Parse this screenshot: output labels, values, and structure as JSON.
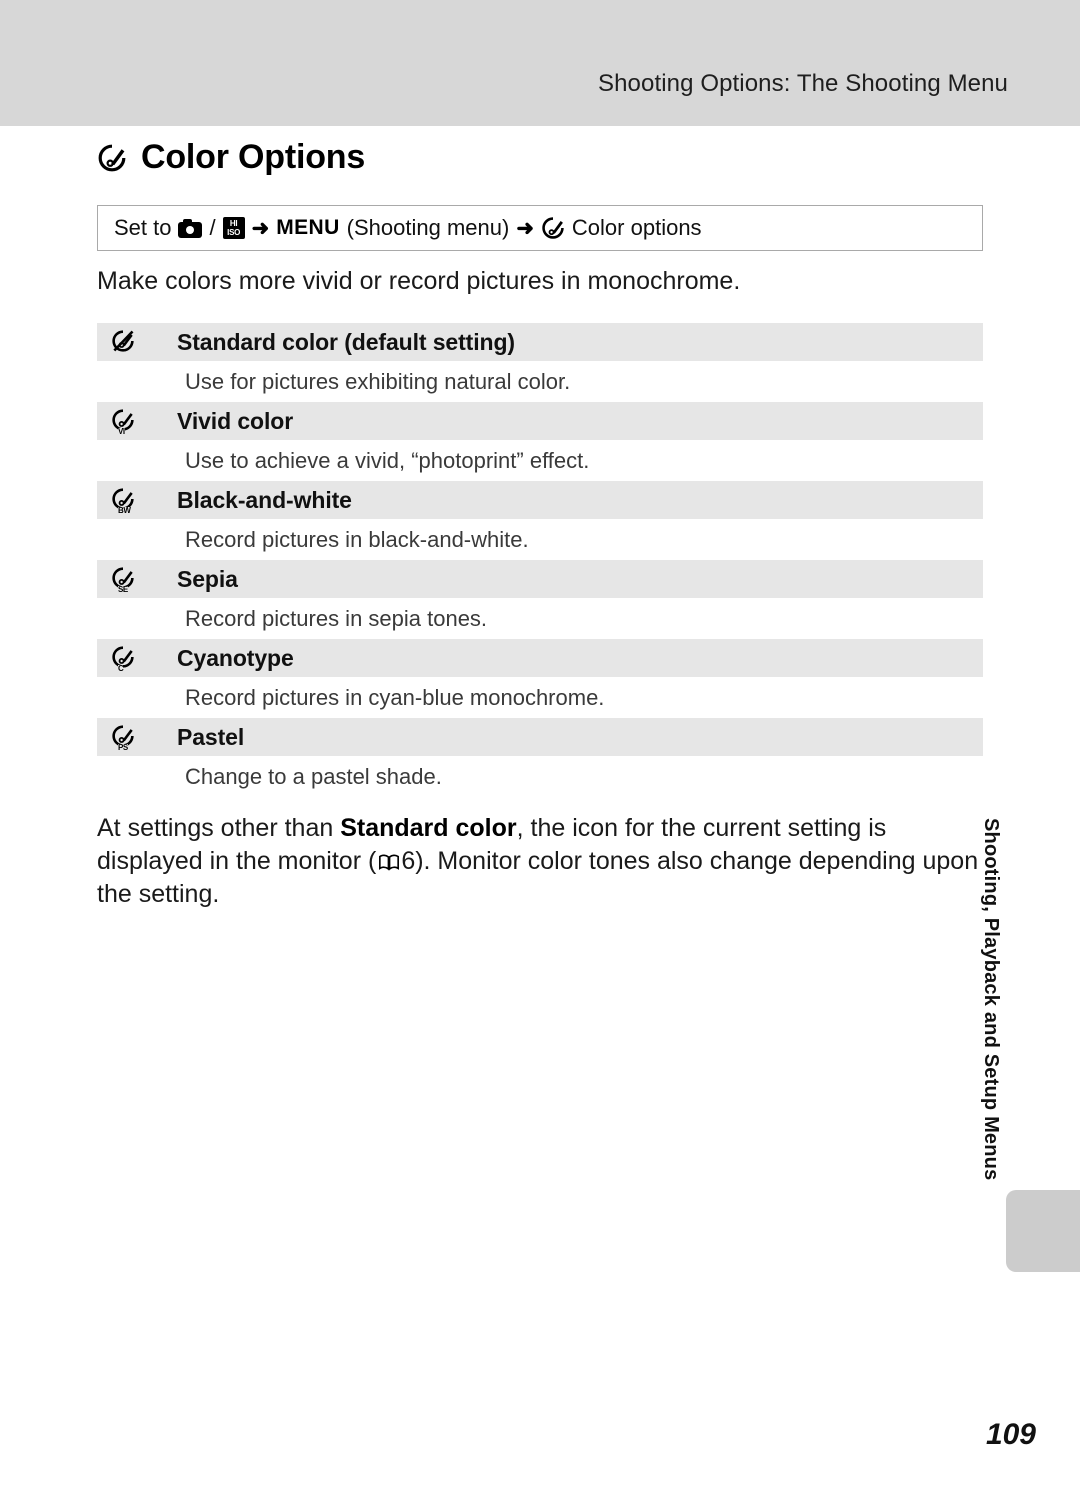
{
  "header": {
    "title": "Shooting Options: The Shooting Menu"
  },
  "section": {
    "icon": "color-options-icon",
    "title": "Color Options"
  },
  "setto": {
    "prefix": "Set to",
    "camera_icon": "camera-mode-icon",
    "separator": "/",
    "hiiso_icon": "high-iso-mode-icon",
    "hiiso_top": "HI",
    "hiiso_bottom": "ISO",
    "arrow1": "➜",
    "menu_label": "MENU",
    "menu_paren": "(Shooting menu)",
    "arrow2": "➜",
    "color_icon": "color-options-icon",
    "target": "Color options"
  },
  "intro": "Make colors more vivid or record pictures in monochrome.",
  "options": [
    {
      "icon": "color-options-off-icon",
      "sub": "",
      "label": "Standard color (default setting)",
      "description": "Use for pictures exhibiting natural color."
    },
    {
      "icon": "color-options-vivid-icon",
      "sub": "VI",
      "label": "Vivid color",
      "description": "Use to achieve a vivid, “photoprint” effect."
    },
    {
      "icon": "color-options-bw-icon",
      "sub": "BW",
      "label": "Black-and-white",
      "description": "Record pictures in black-and-white."
    },
    {
      "icon": "color-options-sepia-icon",
      "sub": "SE",
      "label": "Sepia",
      "description": "Record pictures in sepia tones."
    },
    {
      "icon": "color-options-cyanotype-icon",
      "sub": "C",
      "label": "Cyanotype",
      "description": "Record pictures in cyan-blue monochrome."
    },
    {
      "icon": "color-options-pastel-icon",
      "sub": "PS",
      "label": "Pastel",
      "description": "Change to a pastel shade."
    }
  ],
  "closing": {
    "part1": "At settings other than ",
    "bold": "Standard color",
    "part2": ", the icon for the current setting is displayed in the monitor (",
    "book_icon": "manual-reference-icon",
    "page_ref": "6",
    "part3": "). Monitor color tones also change depending upon the setting."
  },
  "side_tab": {
    "label": "Shooting, Playback and Setup Menus"
  },
  "page_number": "109",
  "colors": {
    "header_band": "#d7d7d7",
    "row_gray": "#e6e6e6",
    "tab_gray": "#cccccc",
    "box_border": "#a9a9a9"
  }
}
